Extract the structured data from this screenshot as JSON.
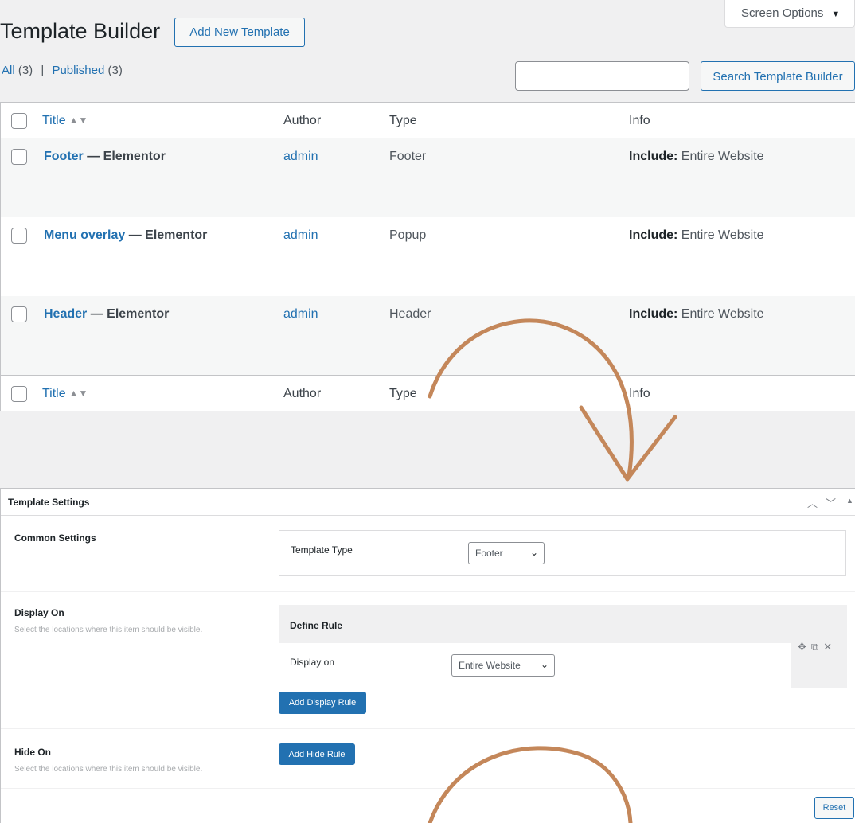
{
  "header": {
    "title": "Template Builder",
    "add_new_label": "Add New Template",
    "screen_options_label": "Screen Options"
  },
  "filters": {
    "all_label": "All",
    "all_count": "(3)",
    "separator": "|",
    "published_label": "Published",
    "published_count": "(3)"
  },
  "search": {
    "placeholder": "",
    "button_label": "Search Template Builder"
  },
  "table": {
    "columns": {
      "title": "Title",
      "author": "Author",
      "type": "Type",
      "info": "Info"
    },
    "rows": [
      {
        "title": "Footer",
        "state": " — Elementor",
        "author": "admin",
        "type": "Footer",
        "info_label": "Include:",
        "info_value": " Entire Website"
      },
      {
        "title": "Menu overlay",
        "state": " — Elementor",
        "author": "admin",
        "type": "Popup",
        "info_label": "Include:",
        "info_value": " Entire Website"
      },
      {
        "title": "Header",
        "state": " — Elementor",
        "author": "admin",
        "type": "Header",
        "info_label": "Include:",
        "info_value": " Entire Website"
      }
    ]
  },
  "settings": {
    "title": "Template Settings",
    "common": {
      "label": "Common Settings",
      "template_type_label": "Template Type",
      "template_type_value": "Footer"
    },
    "display_on": {
      "label": "Display On",
      "description": "Select the locations where this item should be visible.",
      "rule_heading": "Define Rule",
      "display_on_label": "Display on",
      "display_on_value": "Entire Website",
      "add_button": "Add Display Rule"
    },
    "hide_on": {
      "label": "Hide On",
      "description": "Select the locations where this item should be visible.",
      "add_button": "Add Hide Rule"
    },
    "reset_label": "Reset"
  },
  "colors": {
    "link": "#2271b1",
    "primary_button": "#2271b1",
    "annotation_arrow": "#c4875a"
  },
  "icons": [
    "sort-icon",
    "caret-down-icon",
    "chevron-up-icon",
    "chevron-down-icon",
    "triangle-up-icon",
    "move-icon",
    "duplicate-icon",
    "close-icon"
  ]
}
